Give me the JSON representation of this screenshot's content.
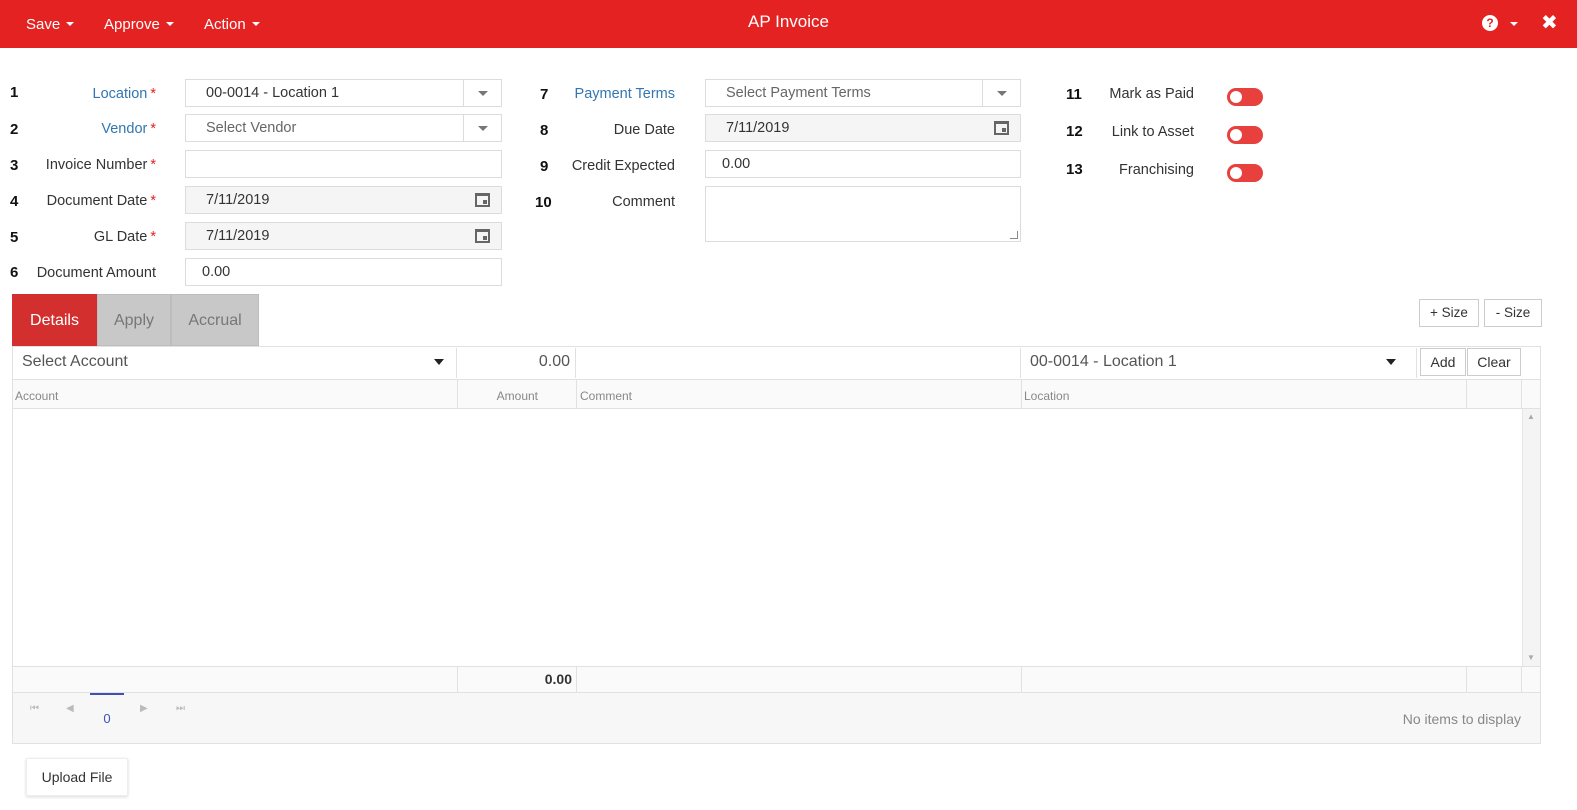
{
  "header": {
    "title": "AP Invoice",
    "menus": [
      "Save",
      "Approve",
      "Action"
    ]
  },
  "form": {
    "location": {
      "num": "1",
      "label": "Location",
      "value": "00-0014 - Location 1"
    },
    "vendor": {
      "num": "2",
      "label": "Vendor",
      "placeholder": "Select Vendor"
    },
    "invoice_number": {
      "num": "3",
      "label": "Invoice Number",
      "value": ""
    },
    "document_date": {
      "num": "4",
      "label": "Document Date",
      "value": "7/11/2019"
    },
    "gl_date": {
      "num": "5",
      "label": "GL Date",
      "value": "7/11/2019"
    },
    "document_amount": {
      "num": "6",
      "label": "Document Amount",
      "value": "0.00"
    },
    "payment_terms": {
      "num": "7",
      "label": "Payment Terms",
      "placeholder": "Select Payment Terms"
    },
    "due_date": {
      "num": "8",
      "label": "Due Date",
      "value": "7/11/2019"
    },
    "credit_expected": {
      "num": "9",
      "label": "Credit Expected",
      "value": "0.00"
    },
    "comment": {
      "num": "10",
      "label": "Comment",
      "value": ""
    },
    "mark_as_paid": {
      "num": "11",
      "label": "Mark as Paid",
      "on": false
    },
    "link_to_asset": {
      "num": "12",
      "label": "Link to Asset",
      "on": false
    },
    "franchising": {
      "num": "13",
      "label": "Franchising",
      "on": false
    },
    "required_mark": "*"
  },
  "tabs": [
    "Details",
    "Apply",
    "Accrual"
  ],
  "size_buttons": {
    "plus": "+ Size",
    "minus": "- Size"
  },
  "entry": {
    "account_placeholder": "Select Account",
    "amount": "0.00",
    "location": "00-0014 - Location 1",
    "add": "Add",
    "clear": "Clear"
  },
  "grid": {
    "columns": [
      "Account",
      "Amount",
      "Comment",
      "Location"
    ],
    "total": "0.00",
    "page": "0",
    "empty_text": "No items to display"
  },
  "upload_label": "Upload File",
  "colors": {
    "brand": "#e52222",
    "active_tab": "#d32f2f",
    "link": "#3276b1"
  }
}
